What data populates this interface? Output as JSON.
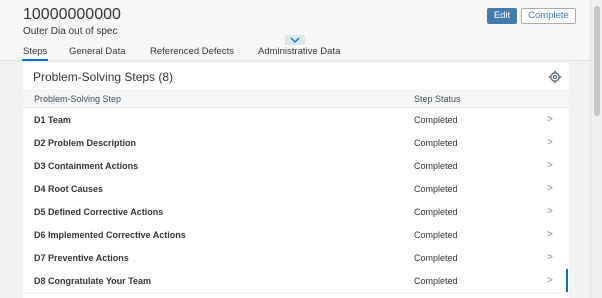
{
  "header": {
    "title": "10000000000",
    "subtitle": "Outer Dia out of spec",
    "edit_label": "Edit",
    "complete_label": "Complete"
  },
  "tabs": [
    {
      "label": "Steps",
      "active": true
    },
    {
      "label": "General Data",
      "active": false
    },
    {
      "label": "Referenced Defects",
      "active": false
    },
    {
      "label": "Administrative Data",
      "active": false
    }
  ],
  "panel": {
    "title": "Problem-Solving Steps (8)",
    "columns": [
      "Problem-Solving Step",
      "Step Status"
    ],
    "rows": [
      {
        "step": "D1 Team",
        "status": "Completed"
      },
      {
        "step": "D2 Problem Description",
        "status": "Completed"
      },
      {
        "step": "D3 Containment Actions",
        "status": "Completed"
      },
      {
        "step": "D4 Root Causes",
        "status": "Completed"
      },
      {
        "step": "D5 Defined Corrective Actions",
        "status": "Completed"
      },
      {
        "step": "D6 Implemented Corrective Actions",
        "status": "Completed"
      },
      {
        "step": "D7 Preventive Actions",
        "status": "Completed"
      },
      {
        "step": "D8 Congratulate Your Team",
        "status": "Completed"
      }
    ]
  },
  "icons": {
    "row_nav": "chevron-right-icon",
    "collapse": "chevron-down-icon",
    "settings": "gear-icon"
  },
  "colors": {
    "accent": "#0a6ed1",
    "edit_button": "#427cac"
  }
}
